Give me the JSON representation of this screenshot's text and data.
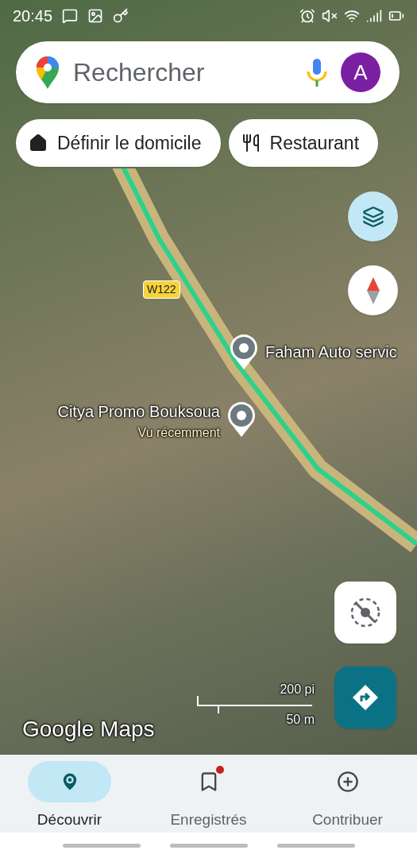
{
  "status_bar": {
    "time": "20:45"
  },
  "search": {
    "placeholder": "Rechercher",
    "avatar_letter": "A"
  },
  "chips": [
    {
      "kind": "home",
      "label": "Définir le domicile"
    },
    {
      "kind": "restaurant",
      "label": "Restaurant"
    }
  ],
  "map": {
    "road_label": "W122",
    "places": [
      {
        "name": "Faham Auto servic"
      },
      {
        "name": "Citya Promo Bouksoua",
        "subtitle": "Vu récemment"
      }
    ],
    "scale": {
      "imperial": "200 pi",
      "metric": "50 m"
    },
    "logo": "Google Maps"
  },
  "bottom_nav": [
    {
      "kind": "explore",
      "label": "Découvrir",
      "selected": true,
      "badge": false
    },
    {
      "kind": "saved",
      "label": "Enregistrés",
      "selected": false,
      "badge": true
    },
    {
      "kind": "contribute",
      "label": "Contribuer",
      "selected": false,
      "badge": false
    }
  ]
}
